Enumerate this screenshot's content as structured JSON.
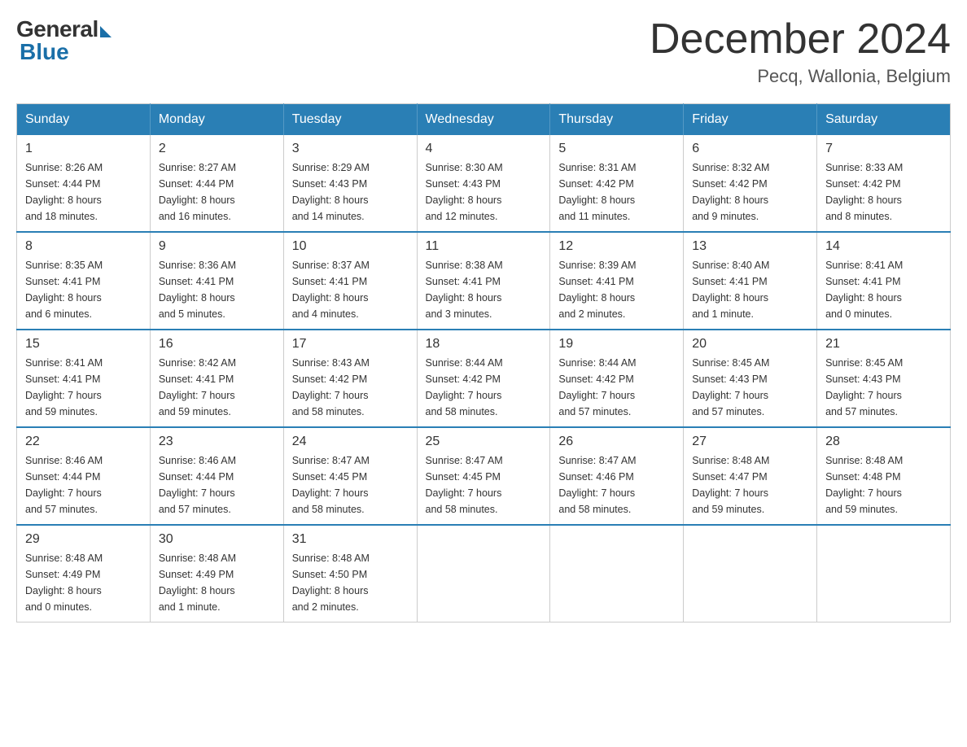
{
  "logo": {
    "general_text": "General",
    "blue_text": "Blue"
  },
  "header": {
    "month_year": "December 2024",
    "location": "Pecq, Wallonia, Belgium"
  },
  "weekdays": [
    "Sunday",
    "Monday",
    "Tuesday",
    "Wednesday",
    "Thursday",
    "Friday",
    "Saturday"
  ],
  "weeks": [
    [
      {
        "day": "1",
        "sunrise": "8:26 AM",
        "sunset": "4:44 PM",
        "daylight": "8 hours and 18 minutes."
      },
      {
        "day": "2",
        "sunrise": "8:27 AM",
        "sunset": "4:44 PM",
        "daylight": "8 hours and 16 minutes."
      },
      {
        "day": "3",
        "sunrise": "8:29 AM",
        "sunset": "4:43 PM",
        "daylight": "8 hours and 14 minutes."
      },
      {
        "day": "4",
        "sunrise": "8:30 AM",
        "sunset": "4:43 PM",
        "daylight": "8 hours and 12 minutes."
      },
      {
        "day": "5",
        "sunrise": "8:31 AM",
        "sunset": "4:42 PM",
        "daylight": "8 hours and 11 minutes."
      },
      {
        "day": "6",
        "sunrise": "8:32 AM",
        "sunset": "4:42 PM",
        "daylight": "8 hours and 9 minutes."
      },
      {
        "day": "7",
        "sunrise": "8:33 AM",
        "sunset": "4:42 PM",
        "daylight": "8 hours and 8 minutes."
      }
    ],
    [
      {
        "day": "8",
        "sunrise": "8:35 AM",
        "sunset": "4:41 PM",
        "daylight": "8 hours and 6 minutes."
      },
      {
        "day": "9",
        "sunrise": "8:36 AM",
        "sunset": "4:41 PM",
        "daylight": "8 hours and 5 minutes."
      },
      {
        "day": "10",
        "sunrise": "8:37 AM",
        "sunset": "4:41 PM",
        "daylight": "8 hours and 4 minutes."
      },
      {
        "day": "11",
        "sunrise": "8:38 AM",
        "sunset": "4:41 PM",
        "daylight": "8 hours and 3 minutes."
      },
      {
        "day": "12",
        "sunrise": "8:39 AM",
        "sunset": "4:41 PM",
        "daylight": "8 hours and 2 minutes."
      },
      {
        "day": "13",
        "sunrise": "8:40 AM",
        "sunset": "4:41 PM",
        "daylight": "8 hours and 1 minute."
      },
      {
        "day": "14",
        "sunrise": "8:41 AM",
        "sunset": "4:41 PM",
        "daylight": "8 hours and 0 minutes."
      }
    ],
    [
      {
        "day": "15",
        "sunrise": "8:41 AM",
        "sunset": "4:41 PM",
        "daylight": "7 hours and 59 minutes."
      },
      {
        "day": "16",
        "sunrise": "8:42 AM",
        "sunset": "4:41 PM",
        "daylight": "7 hours and 59 minutes."
      },
      {
        "day": "17",
        "sunrise": "8:43 AM",
        "sunset": "4:42 PM",
        "daylight": "7 hours and 58 minutes."
      },
      {
        "day": "18",
        "sunrise": "8:44 AM",
        "sunset": "4:42 PM",
        "daylight": "7 hours and 58 minutes."
      },
      {
        "day": "19",
        "sunrise": "8:44 AM",
        "sunset": "4:42 PM",
        "daylight": "7 hours and 57 minutes."
      },
      {
        "day": "20",
        "sunrise": "8:45 AM",
        "sunset": "4:43 PM",
        "daylight": "7 hours and 57 minutes."
      },
      {
        "day": "21",
        "sunrise": "8:45 AM",
        "sunset": "4:43 PM",
        "daylight": "7 hours and 57 minutes."
      }
    ],
    [
      {
        "day": "22",
        "sunrise": "8:46 AM",
        "sunset": "4:44 PM",
        "daylight": "7 hours and 57 minutes."
      },
      {
        "day": "23",
        "sunrise": "8:46 AM",
        "sunset": "4:44 PM",
        "daylight": "7 hours and 57 minutes."
      },
      {
        "day": "24",
        "sunrise": "8:47 AM",
        "sunset": "4:45 PM",
        "daylight": "7 hours and 58 minutes."
      },
      {
        "day": "25",
        "sunrise": "8:47 AM",
        "sunset": "4:45 PM",
        "daylight": "7 hours and 58 minutes."
      },
      {
        "day": "26",
        "sunrise": "8:47 AM",
        "sunset": "4:46 PM",
        "daylight": "7 hours and 58 minutes."
      },
      {
        "day": "27",
        "sunrise": "8:48 AM",
        "sunset": "4:47 PM",
        "daylight": "7 hours and 59 minutes."
      },
      {
        "day": "28",
        "sunrise": "8:48 AM",
        "sunset": "4:48 PM",
        "daylight": "7 hours and 59 minutes."
      }
    ],
    [
      {
        "day": "29",
        "sunrise": "8:48 AM",
        "sunset": "4:49 PM",
        "daylight": "8 hours and 0 minutes."
      },
      {
        "day": "30",
        "sunrise": "8:48 AM",
        "sunset": "4:49 PM",
        "daylight": "8 hours and 1 minute."
      },
      {
        "day": "31",
        "sunrise": "8:48 AM",
        "sunset": "4:50 PM",
        "daylight": "8 hours and 2 minutes."
      },
      null,
      null,
      null,
      null
    ]
  ]
}
